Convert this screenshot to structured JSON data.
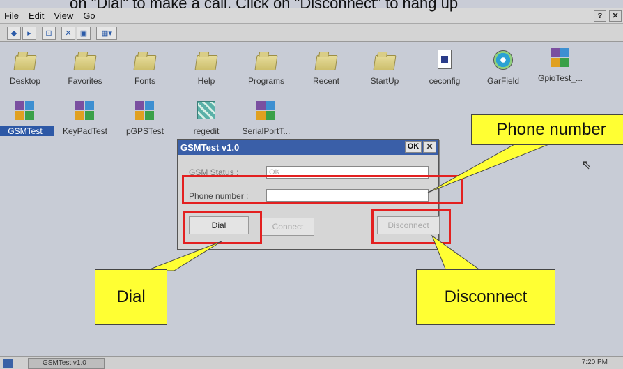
{
  "caption": "on \"Dial\" to make a call. Click on \"Disconnect\" to hang up",
  "menubar": {
    "items": [
      "File",
      "Edit",
      "View",
      "Go"
    ],
    "help_btn": "?",
    "close_btn": "✕"
  },
  "toolbar": {
    "buttons": [
      "back-icon",
      "forward-icon",
      "up-folder-icon",
      "delete-icon",
      "properties-icon",
      "views-icon"
    ],
    "glyphs": [
      "◆",
      "▸",
      "⊡",
      "✕",
      "▣",
      "▦▾"
    ]
  },
  "desktop": {
    "row1": [
      "Desktop",
      "Favorites",
      "Fonts",
      "Help",
      "Programs",
      "Recent",
      "StartUp",
      "ceconfig",
      "GarField",
      "GpioTest_..."
    ],
    "row2": [
      "GSMTest",
      "KeyPadTest",
      "pGPSTest",
      "regedit",
      "SerialPortT..."
    ]
  },
  "dialog": {
    "title": "GSMTest v1.0",
    "ok_label": "OK",
    "close_label": "✕",
    "gsm_status_label": "GSM Status :",
    "gsm_status_value": "OK",
    "phone_label": "Phone number :",
    "phone_value": "",
    "dial_label": "Dial",
    "connect_label": "Connect",
    "disconnect_label": "Disconnect"
  },
  "callouts": {
    "phone": "Phone number",
    "dial": "Dial",
    "disconnect": "Disconnect"
  },
  "taskbar": {
    "task_label": "GSMTest v1.0",
    "clock": "7:20 PM"
  },
  "colors": {
    "highlight": "#e32020",
    "callout": "#ffff33",
    "title_bar": "#3a5fa8"
  }
}
